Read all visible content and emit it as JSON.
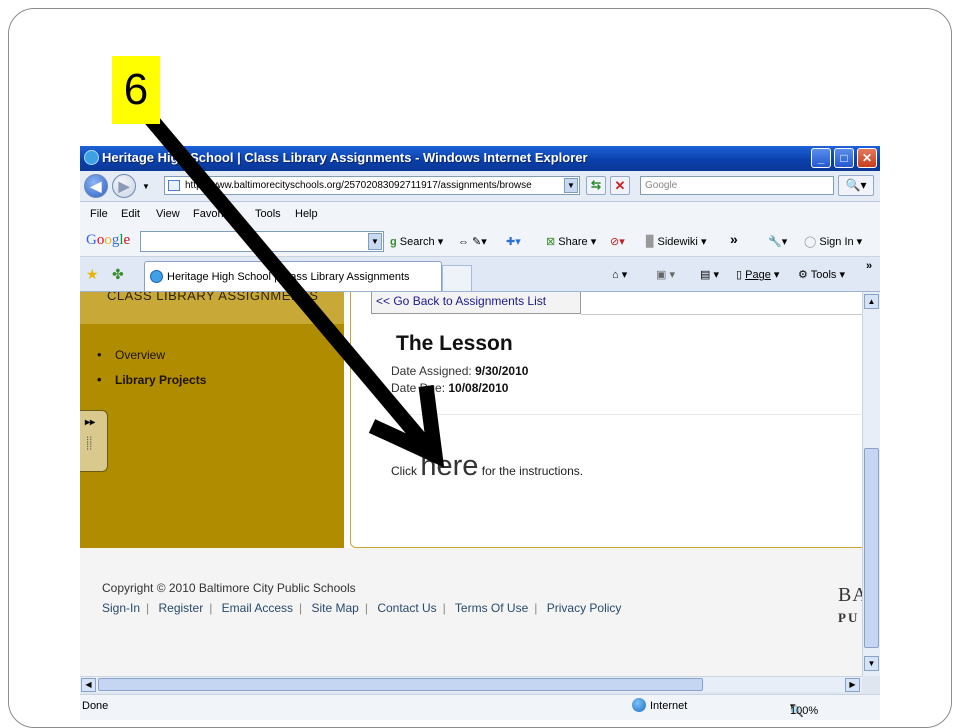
{
  "slide": {
    "step_number": "6"
  },
  "window": {
    "title": "Heritage High School | Class Library Assignments - Windows Internet Explorer",
    "min": "_",
    "max": "□",
    "close": "✕"
  },
  "address_bar": {
    "url": "http://www.baltimorecityschools.org/25702083092711917/assignments/browse",
    "search_placeholder": "Google"
  },
  "menu": [
    "File",
    "Edit",
    "View",
    "Favorites",
    "Tools",
    "Help"
  ],
  "google_toolbar": {
    "logo": "Google",
    "search_label": "Search",
    "share_label": "Share",
    "sidewiki_label": "Sidewiki",
    "more": "»",
    "signin_label": "Sign In"
  },
  "tab": {
    "label": "Heritage High School | Class Library Assignments"
  },
  "commands": {
    "page": "Page",
    "tools": "Tools",
    "more": "»"
  },
  "sidebar": {
    "heading": "CLASS LIBRARY ASSIGNMENTS",
    "items": [
      {
        "label": "Overview",
        "bold": false
      },
      {
        "label": "Library Projects",
        "bold": true
      }
    ]
  },
  "main": {
    "back_link": "<< Go Back to Assignments List",
    "title": "The Lesson",
    "date_assigned_label": "Date Assigned:",
    "date_assigned": "9/30/2010",
    "date_due_label": "Date Due:",
    "date_due": "10/08/2010",
    "instr_before": "Click",
    "instr_link": "here",
    "instr_after": "for the instructions."
  },
  "footer": {
    "copyright": "Copyright © 2010 Baltimore City Public Schools",
    "links": [
      "Sign-In",
      "Register",
      "Email Access",
      "Site Map",
      "Contact Us",
      "Terms Of Use",
      "Privacy Policy"
    ],
    "logo_top": "BA",
    "logo_bottom": "PU"
  },
  "status": {
    "text": "Done",
    "zone": "Internet",
    "zoom": "100%"
  },
  "colors": {
    "sidebar_bg": "#b08c00",
    "badge_bg": "#ffff00",
    "titlebar": "#0a3ea8"
  }
}
